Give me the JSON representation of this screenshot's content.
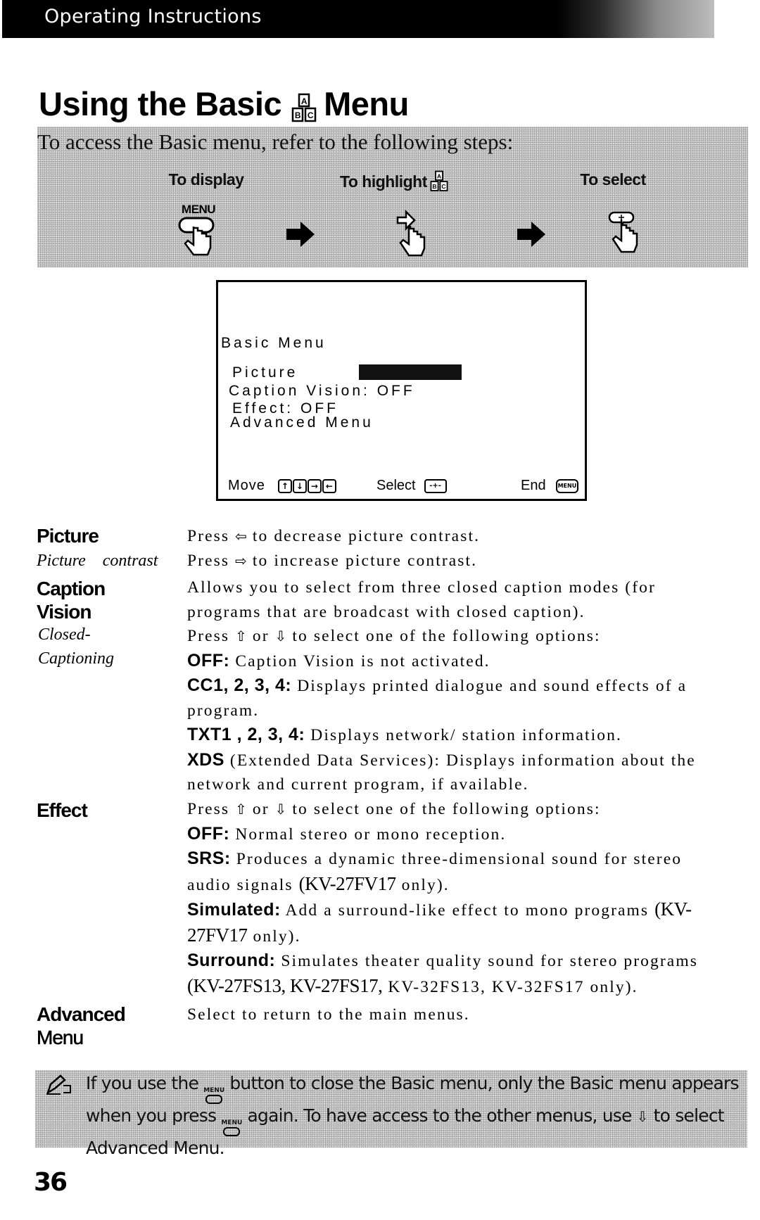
{
  "header": {
    "section_title": "Operating Instructions"
  },
  "page_title": {
    "before_icon": "Using the Basic",
    "icon": "abc-blocks-icon",
    "after_icon": "Menu"
  },
  "steps_panel": {
    "intro": "To access the Basic menu, refer to the following steps:",
    "steps": [
      {
        "label": "To display",
        "button_label": "MENU",
        "icon": "hand-press-menu-icon"
      },
      {
        "label": "To highlight",
        "label_icon": "abc-blocks-icon",
        "icon": "hand-press-arrow-icon"
      },
      {
        "label": "To select",
        "icon": "hand-press-select-icon"
      }
    ]
  },
  "tv_screen": {
    "menu_title": "Basic Menu",
    "items": [
      {
        "label": "Picture",
        "highlighted": true
      },
      {
        "label": "Caption Vision: OFF"
      },
      {
        "label": "Effect: OFF"
      },
      {
        "label": "Advanced Menu"
      }
    ],
    "footer": {
      "move_label": "Move",
      "move_keys": [
        "↑",
        "↓",
        "→",
        "←"
      ],
      "select_label": "Select",
      "select_key": "-+-",
      "end_label": "End",
      "end_key": "MENU"
    }
  },
  "sections": {
    "picture": {
      "term": "Picture",
      "sub_term": "Picture contrast",
      "lines": [
        {
          "pre": "Press",
          "glyph": "⇦",
          "post": "to decrease picture contrast."
        },
        {
          "pre": "Press",
          "glyph": "⇨",
          "post": "to increase picture contrast."
        }
      ]
    },
    "caption_vision": {
      "term_line1": "Caption",
      "term_line2": "Vision",
      "sub_term_line1": "Closed-",
      "sub_term_line2": "Captioning",
      "intro": "Allows you to select from three closed caption modes (for programs that are broadcast with closed caption).",
      "press_pre": "Press",
      "press_glyph1": "⇧",
      "press_mid": "or",
      "press_glyph2": "⇩",
      "press_post": "to select one of the following options:",
      "options": [
        {
          "key": "OFF:",
          "text": "Caption Vision is not activated."
        },
        {
          "key": "CC1, 2, 3, 4:",
          "text": "Displays printed dialogue and sound effects of a program."
        },
        {
          "key": "TXT1 , 2, 3, 4:",
          "text": "Displays network/ station information."
        },
        {
          "key": "XDS",
          "text": "(Extended Data Services): Displays information about the network and current program, if available."
        }
      ]
    },
    "effect": {
      "term": "Effect",
      "press_pre": "Press",
      "press_glyph1": "⇧",
      "press_mid": "or",
      "press_glyph2": "⇩",
      "press_post": "to select one of the following options:",
      "options": [
        {
          "key": "OFF:",
          "text": "Normal stereo or mono reception."
        },
        {
          "key": "SRS:",
          "text": "Produces a dynamic three-dimensional sound for stereo audio signals",
          "models": "(KV-27FV17",
          "tail": "only)."
        },
        {
          "key": "Simulated:",
          "text": "Add a surround-like effect to mono programs",
          "models": "(KV-27FV17",
          "tail": "only)."
        },
        {
          "key": "Surround:",
          "text": "Simulates theater quality sound for stereo programs",
          "models": "(KV-27FS13, KV-27FS17,",
          "tail": "KV-32FS13, KV-32FS17 only)."
        }
      ]
    },
    "advanced_menu": {
      "term_line1": "Advanced",
      "term_line2": "Menu",
      "text": "Select to return to the main menus."
    }
  },
  "note": {
    "icon": "note-pencil-icon",
    "part1": "If you use the",
    "button_label": "MENU",
    "part2": "button to close the Basic menu, only the Basic menu appears when you press",
    "part3": "again. To have access to the other menus, use",
    "glyph": "⇩",
    "part4": "to select Advanced Menu."
  },
  "page_number": "36"
}
